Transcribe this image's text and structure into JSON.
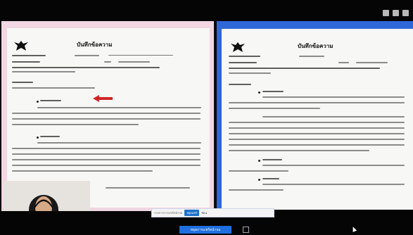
{
  "screen": {
    "accent": "#1f6fe0",
    "background": "#0a0a0a"
  },
  "documents": {
    "left": {
      "title": "บันทึกข้อความ",
      "frame_color": "#f0d7e2",
      "annotation": "red-arrow-icon"
    },
    "right": {
      "title": "บันทึกข้อความ",
      "frame_color": "#2f67d8"
    }
  },
  "share_toolbar": {
    "message": "รายการการแชร์หน้าจอ",
    "stop_label": "หยุดแชร์",
    "hide_label": "ซ่อน"
  },
  "taskbar": {
    "share_label": "หยุดการแชร์หน้าจอ"
  },
  "icons": {
    "emblem": "garuda-emblem-icon",
    "arrow": "red-arrow-icon",
    "square": "square-icon",
    "cursor": "cursor-icon"
  }
}
